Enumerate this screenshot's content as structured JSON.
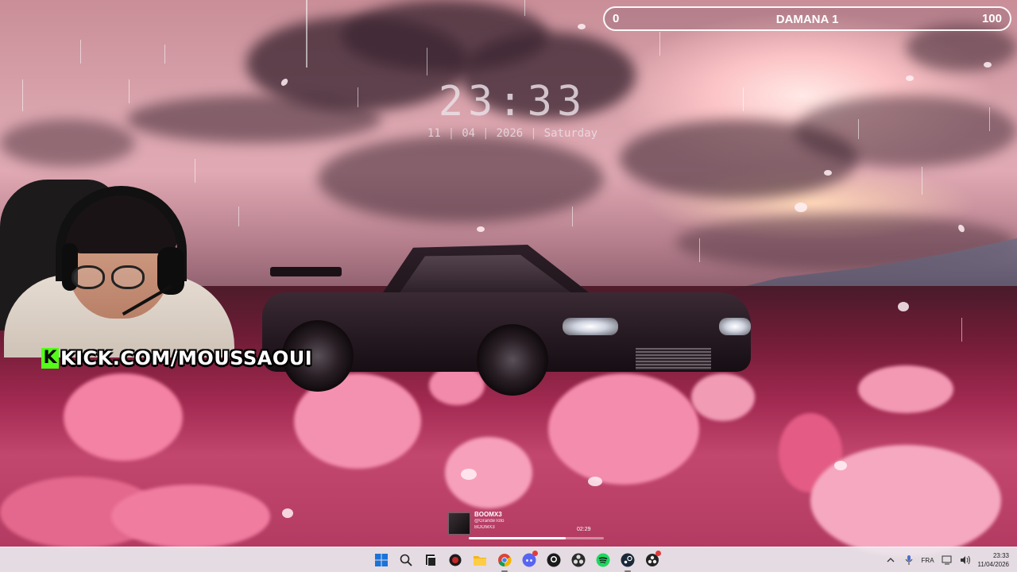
{
  "goal": {
    "min": "0",
    "title": "DAMANA 1",
    "max": "100",
    "progress": 0
  },
  "clock": {
    "time": "23:33",
    "day": "11",
    "month": "04",
    "year": "2026",
    "weekday": "Saturday",
    "separator": "|"
  },
  "webcam": {
    "kick_logo": "K",
    "channel_url": "KICK.COM/MOUSSAOUI"
  },
  "media": {
    "title": "BOOMX3",
    "artist": "@GrandeToto",
    "album": "BOOMX3",
    "time": "02:29",
    "progress": 0.72
  },
  "taskbar": {
    "apps": [
      {
        "name": "windows-start-icon"
      },
      {
        "name": "search-icon"
      },
      {
        "name": "task-view-icon"
      },
      {
        "name": "media-player-icon"
      },
      {
        "name": "file-explorer-icon"
      },
      {
        "name": "chrome-icon",
        "active": true
      },
      {
        "name": "discord-icon",
        "badge": true
      },
      {
        "name": "github-icon"
      },
      {
        "name": "obs-icon"
      },
      {
        "name": "spotify-icon"
      },
      {
        "name": "steam-icon",
        "active": true
      },
      {
        "name": "obs-alt-icon",
        "badge": true
      }
    ],
    "tray": {
      "language": "FRA",
      "time": "23:33",
      "date": "11/04/2026"
    }
  },
  "colors": {
    "kick_green": "#53fc18",
    "taskbar_bg": "#ece4ea"
  }
}
